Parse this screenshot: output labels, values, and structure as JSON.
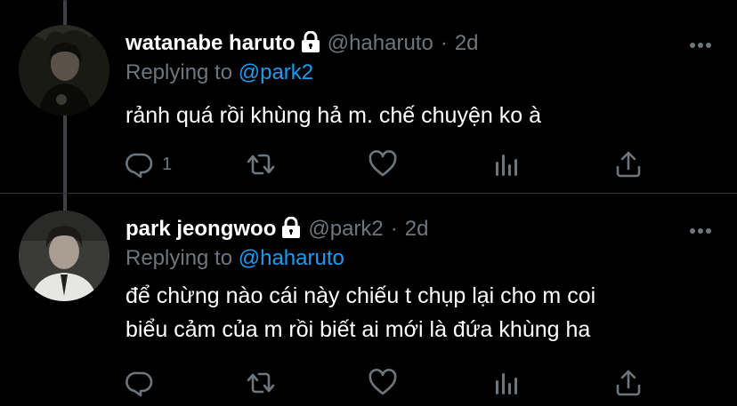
{
  "tweets": [
    {
      "display_name": "watanabe haruto",
      "handle": "@haharuto",
      "separator": "·",
      "time": "2d",
      "replying_prefix": "Replying to",
      "replying_to": "@park2",
      "text_lines": [
        "rảnh quá rồi khùng hả m. chế chuyện ko à"
      ],
      "reply_count": "1",
      "protected": true
    },
    {
      "display_name": "park jeongwoo",
      "handle": "@park2",
      "separator": "·",
      "time": "2d",
      "replying_prefix": "Replying to",
      "replying_to": "@haharuto",
      "text_lines": [
        "để chừng nào cái này chiếu t chụp lại cho m coi",
        "biểu cảm của m rồi biết ai mới là đứa khùng ha"
      ],
      "reply_count": "",
      "protected": true
    }
  ],
  "icons": {
    "reply": "reply-icon",
    "retweet": "retweet-icon",
    "like": "heart-icon",
    "stats": "analytics-icon",
    "share": "share-icon",
    "more": "more-icon",
    "lock": "lock-icon"
  },
  "colors": {
    "background": "#000000",
    "text": "#ffffff",
    "secondary": "#6e767d",
    "accent": "#1d9bf0",
    "thread_line": "#3d4044"
  }
}
